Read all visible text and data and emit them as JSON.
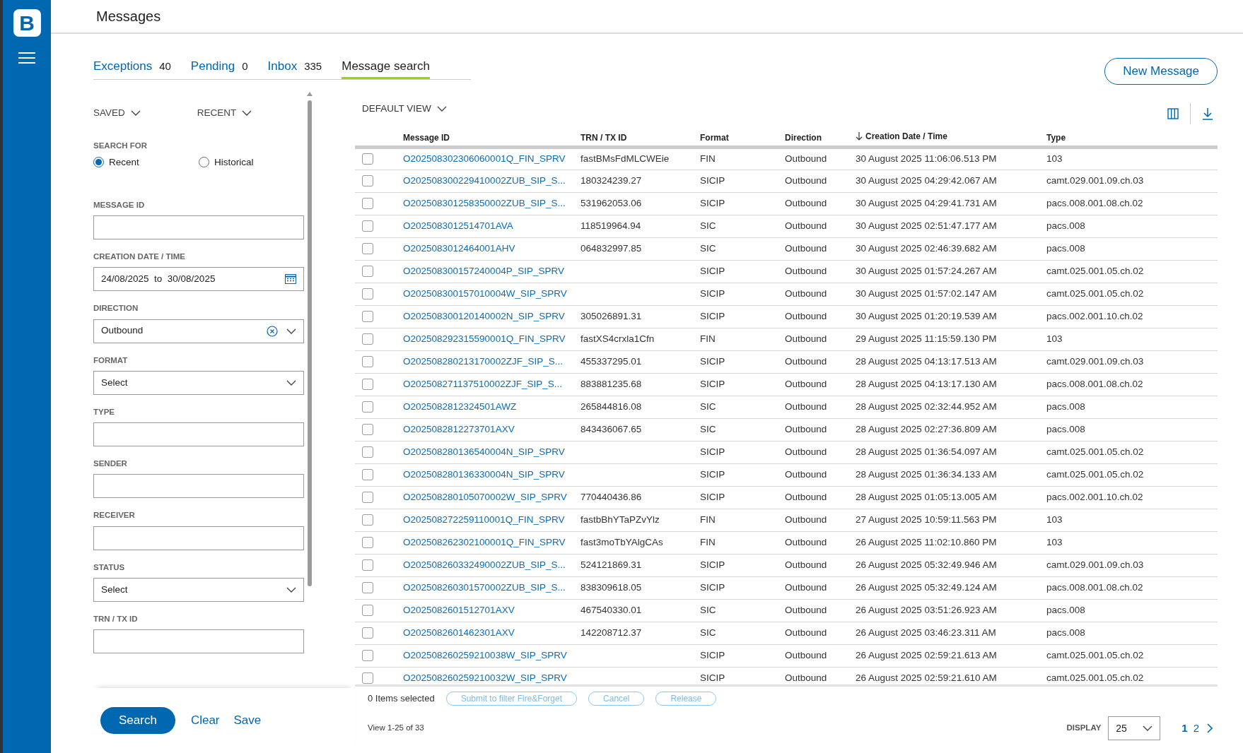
{
  "app": {
    "logo": "B"
  },
  "header": {
    "title": "Messages"
  },
  "tabs": [
    {
      "label": "Exceptions",
      "count": "40",
      "selected": false
    },
    {
      "label": "Pending",
      "count": "0",
      "selected": false
    },
    {
      "label": "Inbox",
      "count": "335",
      "selected": false
    },
    {
      "label": "Message search",
      "selected": true
    }
  ],
  "new_message_button": "New Message",
  "filters": {
    "menus": [
      "SAVED",
      "RECENT"
    ],
    "search_for": {
      "label": "SEARCH FOR",
      "options": [
        {
          "label": "Recent",
          "selected": true
        },
        {
          "label": "Historical",
          "selected": false
        }
      ]
    },
    "fields": [
      {
        "kind": "text",
        "label": "MESSAGE ID"
      },
      {
        "kind": "date",
        "label": "CREATION DATE / TIME",
        "from": "24/08/2025",
        "separator": "to",
        "to": "30/08/2025"
      },
      {
        "kind": "select",
        "label": "DIRECTION",
        "value": "Outbound",
        "clearable": true
      },
      {
        "kind": "select",
        "label": "FORMAT",
        "value": "Select",
        "clearable": false
      },
      {
        "kind": "text",
        "label": "TYPE"
      },
      {
        "kind": "text",
        "label": "SENDER"
      },
      {
        "kind": "text",
        "label": "RECEIVER"
      },
      {
        "kind": "select",
        "label": "STATUS",
        "value": "Select",
        "clearable": false
      },
      {
        "kind": "text",
        "label": "TRN / TX ID"
      }
    ],
    "actions": [
      {
        "kind": "primary",
        "label": "Search"
      },
      {
        "kind": "link",
        "label": "Clear"
      },
      {
        "kind": "link",
        "label": "Save"
      }
    ]
  },
  "view": {
    "label": "DEFAULT VIEW"
  },
  "table": {
    "columns": [
      {
        "label": "Message ID",
        "sorted": false
      },
      {
        "label": "TRN / TX ID",
        "sorted": false
      },
      {
        "label": "Format",
        "sorted": false
      },
      {
        "label": "Direction",
        "sorted": false
      },
      {
        "label": "Creation Date / Time",
        "sorted": true
      },
      {
        "label": "Type",
        "sorted": false
      }
    ],
    "rows": [
      {
        "checked": false,
        "cells": [
          "O202508302306060001Q_FIN_SPRV",
          "fastBMsFdMLCWEie",
          "FIN",
          "Outbound",
          "30 August 2025 11:06:06.513 PM",
          "103"
        ]
      },
      {
        "checked": false,
        "cells": [
          "O202508300229410002ZUB_SIP_S...",
          "180324239.27",
          "SICIP",
          "Outbound",
          "30 August 2025 04:29:42.067 AM",
          "camt.029.001.09.ch.03"
        ]
      },
      {
        "checked": false,
        "cells": [
          "O202508301258350002ZUB_SIP_S...",
          "531962053.06",
          "SICIP",
          "Outbound",
          "30 August 2025 04:29:41.731 AM",
          "pacs.008.001.08.ch.02"
        ]
      },
      {
        "checked": false,
        "cells": [
          "O2025083012514701AVA",
          "118519964.94",
          "SIC",
          "Outbound",
          "30 August 2025 02:51:47.177 AM",
          "pacs.008"
        ]
      },
      {
        "checked": false,
        "cells": [
          "O2025083012464001AHV",
          "064832997.85",
          "SIC",
          "Outbound",
          "30 August 2025 02:46:39.682 AM",
          "pacs.008"
        ]
      },
      {
        "checked": false,
        "cells": [
          "O202508300157240004P_SIP_SPRV",
          "",
          "SICIP",
          "Outbound",
          "30 August 2025 01:57:24.267 AM",
          "camt.025.001.05.ch.02"
        ]
      },
      {
        "checked": false,
        "cells": [
          "O202508300157010004W_SIP_SPRV",
          "",
          "SICIP",
          "Outbound",
          "30 August 2025 01:57:02.147 AM",
          "camt.025.001.05.ch.02"
        ]
      },
      {
        "checked": false,
        "cells": [
          "O202508300120140002N_SIP_SPRV",
          "305026891.31",
          "SICIP",
          "Outbound",
          "30 August 2025 01:20:19.539 AM",
          "pacs.002.001.10.ch.02"
        ]
      },
      {
        "checked": false,
        "cells": [
          "O202508292315590001Q_FIN_SPRV",
          "fastXS4crxla1Cfn",
          "FIN",
          "Outbound",
          "29 August 2025 11:15:59.130 PM",
          "103"
        ]
      },
      {
        "checked": false,
        "cells": [
          "O202508280213170002ZJF_SIP_S...",
          "455337295.01",
          "SICIP",
          "Outbound",
          "28 August 2025 04:13:17.513 AM",
          "camt.029.001.09.ch.03"
        ]
      },
      {
        "checked": false,
        "cells": [
          "O202508271137510002ZJF_SIP_S...",
          "883881235.68",
          "SICIP",
          "Outbound",
          "28 August 2025 04:13:17.130 AM",
          "pacs.008.001.08.ch.02"
        ]
      },
      {
        "checked": false,
        "cells": [
          "O2025082812324501AWZ",
          "265844816.08",
          "SIC",
          "Outbound",
          "28 August 2025 02:32:44.952 AM",
          "pacs.008"
        ]
      },
      {
        "checked": false,
        "cells": [
          "O2025082812273701AXV",
          "843436067.65",
          "SIC",
          "Outbound",
          "28 August 2025 02:27:36.809 AM",
          "pacs.008"
        ]
      },
      {
        "checked": false,
        "cells": [
          "O202508280136540004N_SIP_SPRV",
          "",
          "SICIP",
          "Outbound",
          "28 August 2025 01:36:54.097 AM",
          "camt.025.001.05.ch.02"
        ]
      },
      {
        "checked": false,
        "cells": [
          "O202508280136330004N_SIP_SPRV",
          "",
          "SICIP",
          "Outbound",
          "28 August 2025 01:36:34.133 AM",
          "camt.025.001.05.ch.02"
        ]
      },
      {
        "checked": false,
        "cells": [
          "O202508280105070002W_SIP_SPRV",
          "770440436.86",
          "SICIP",
          "Outbound",
          "28 August 2025 01:05:13.005 AM",
          "pacs.002.001.10.ch.02"
        ]
      },
      {
        "checked": false,
        "cells": [
          "O202508272259110001Q_FIN_SPRV",
          "fastbBhYTaPZvYlz",
          "FIN",
          "Outbound",
          "27 August 2025 10:59:11.563 PM",
          "103"
        ]
      },
      {
        "checked": false,
        "cells": [
          "O202508262302100001Q_FIN_SPRV",
          "fast3moTbYAlgCAs",
          "FIN",
          "Outbound",
          "26 August 2025 11:02:10.860 PM",
          "103"
        ]
      },
      {
        "checked": false,
        "cells": [
          "O202508260332490002ZUB_SIP_S...",
          "524121869.31",
          "SICIP",
          "Outbound",
          "26 August 2025 05:32:49.946 AM",
          "camt.029.001.09.ch.03"
        ]
      },
      {
        "checked": false,
        "cells": [
          "O202508260301570002ZUB_SIP_S...",
          "838309618.05",
          "SICIP",
          "Outbound",
          "26 August 2025 05:32:49.124 AM",
          "pacs.008.001.08.ch.02"
        ]
      },
      {
        "checked": false,
        "cells": [
          "O2025082601512701AXV",
          "467540330.01",
          "SIC",
          "Outbound",
          "26 August 2025 03:51:26.923 AM",
          "pacs.008"
        ]
      },
      {
        "checked": false,
        "cells": [
          "O2025082601462301AXV",
          "142208712.37",
          "SIC",
          "Outbound",
          "26 August 2025 03:46:23.311 AM",
          "pacs.008"
        ]
      },
      {
        "checked": false,
        "cells": [
          "O202508260259210038W_SIP_SPRV",
          "",
          "SICIP",
          "Outbound",
          "26 August 2025 02:59:21.613 AM",
          "camt.025.001.05.ch.02"
        ]
      },
      {
        "checked": false,
        "cells": [
          "O202508260259210032W_SIP_SPRV",
          "",
          "SICIP",
          "Outbound",
          "26 August 2025 02:59:21.610 AM",
          "camt.025.001.05.ch.02"
        ]
      }
    ]
  },
  "footer": {
    "selection": "0 Items selected",
    "bulk_actions": [
      {
        "label": "Submit to filter Fire&Forget",
        "disabled": true
      },
      {
        "label": "Cancel",
        "disabled": true
      },
      {
        "label": "Release",
        "disabled": true
      }
    ],
    "range": "View 1-25 of 33",
    "display_label": "DISPLAY",
    "display_value": "25",
    "pages": [
      {
        "label": "1",
        "selected": true
      },
      {
        "label": "2",
        "selected": false
      }
    ]
  }
}
